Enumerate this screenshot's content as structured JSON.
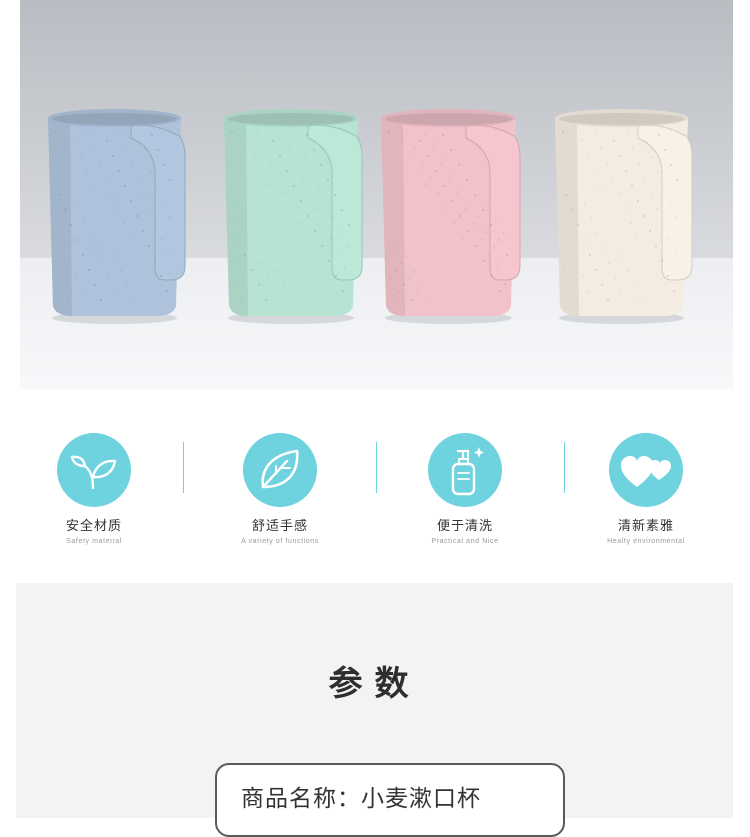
{
  "hero": {
    "cup_colors": [
      "#aec2db",
      "#b7e3d3",
      "#f1c2ca",
      "#f4ece1"
    ]
  },
  "features": [
    {
      "icon": "sprout-icon",
      "title": "安全材质",
      "subtitle": "Safety material"
    },
    {
      "icon": "leaf-icon",
      "title": "舒适手感",
      "subtitle": "A variety of functions"
    },
    {
      "icon": "bottle-icon",
      "title": "便于清洗",
      "subtitle": "Practical and Nice"
    },
    {
      "icon": "hearts-icon",
      "title": "清新素雅",
      "subtitle": "Healty environmental"
    }
  ],
  "accent_color": "#6fd3df",
  "params": {
    "heading": "参数",
    "rows": [
      {
        "text": "商品名称：小麦漱口杯"
      }
    ]
  }
}
